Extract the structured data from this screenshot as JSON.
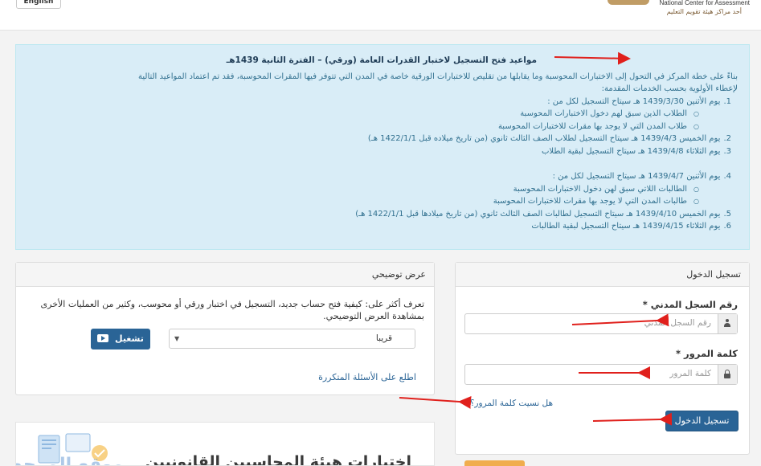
{
  "header": {
    "language_button": "English",
    "logo_en": "National Center for Assessment",
    "logo_ar": "أحد مراكز هيئة تقويم التعليم"
  },
  "notice": {
    "title": "مواعيد فتح التسجيل لاختبار القدرات العامة (ورقي) – الفترة الثانية 1439هـ",
    "intro_1": "بناءً على خطة المركز في التحول إلى الاختبارات المحوسبة وما يقابلها من تقليص للاختبارات الورقية خاصة في المدن التي تتوفر فيها المقرات المحوسبة، فقد تم اعتماد المواعيد التالية",
    "intro_2": "لإعطاء الأولوية بحسب الخدمات المقدمة:",
    "items": [
      {
        "num": "1.",
        "text": "يوم الأثنين 1439/3/30 هـ سيتاح التسجيل لكل من :"
      },
      {
        "num": "2.",
        "text": "يوم الخميس 1439/4/3 هـ سيتاح التسجيل لطلاب الصف الثالث ثانوي (من تاريخ ميلاده قبل 1422/1/1 هـ)"
      },
      {
        "num": "3.",
        "text": "يوم الثلاثاء 1439/4/8 هـ سيتاح التسجيل لبقية الطلاب"
      },
      {
        "num": "4.",
        "text": "يوم الأثنين 1439/4/7 هـ سيتاح التسجيل لكل من :"
      },
      {
        "num": "5.",
        "text": "يوم الخميس 1439/4/10 هـ سيتاح التسجيل لطالبات الصف الثالث ثانوي (من تاريخ ميلادها قبل 1422/1/1 هـ)"
      },
      {
        "num": "6.",
        "text": "يوم الثلاثاء 1439/4/15 هـ سيتاح التسجيل لبقية الطالبات"
      }
    ],
    "sub_items_1": [
      "الطلاب الذين سبق لهم دخول الاختبارات المحوسبة",
      "طلاب المدن التي لا يوجد بها مقرات للاختبارات المحوسبة"
    ],
    "sub_items_4": [
      "الطالبات اللاتي سبق لهن دخول الاختبارات المحوسبة",
      "طالبات المدن التي لا يوجد بها مقرات للاختبارات المحوسبة"
    ]
  },
  "demo_panel": {
    "title": "عرض توضيحي",
    "description": "تعرف أكثر على: كيفية فتح حساب جديد، التسجيل في اختبار ورقي أو محوسب، وكثير من العمليات الأخرى بمشاهدة العرض التوضيحي.",
    "select_value": "قريبا",
    "play_button": "تشغيل",
    "faq_link": "اطلع على الأسئلة المتكررة"
  },
  "login_panel": {
    "title": "تسجيل الدخول",
    "id_label": "رقم السجل المدني *",
    "id_placeholder": "رقم السجل المدني",
    "password_label": "كلمة المرور *",
    "password_placeholder": "كلمة المرور",
    "forgot_link": "هل نسيت كلمة المرور؟",
    "submit_button": "تسجيل الدخول"
  },
  "banner": {
    "text": "اختبارات هيئة المحاسبين القانونيين",
    "watermark": "موقع المرجع"
  },
  "colors": {
    "notice_bg": "#d9edf7",
    "primary": "#2a6496",
    "annotation_arrow": "#e0201c",
    "accent_orange": "#f0ad4e"
  }
}
